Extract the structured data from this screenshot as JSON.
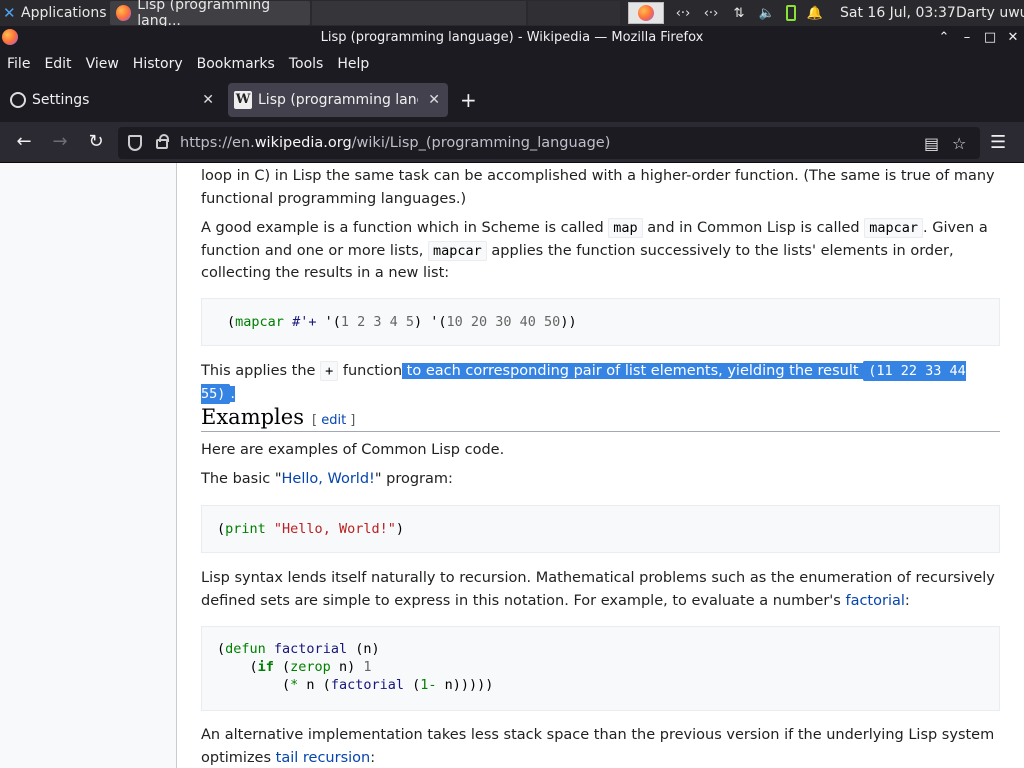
{
  "panel": {
    "applications_label": "Applications",
    "task_label": "Lisp (programming lang...",
    "clock": "Sat 16 Jul, 03:37",
    "user": "Darty uwu"
  },
  "window": {
    "title": "Lisp (programming language) - Wikipedia — Mozilla Firefox"
  },
  "menubar": [
    "File",
    "Edit",
    "View",
    "History",
    "Bookmarks",
    "Tools",
    "Help"
  ],
  "tabs": [
    {
      "label": "Settings"
    },
    {
      "label": "Lisp (programming language) - Wikipedia"
    }
  ],
  "urlbar": {
    "prefix": "https://en.",
    "domain": "wikipedia.org",
    "path": "/wiki/Lisp_(programming_language)"
  },
  "article": {
    "p1": "loop in C) in Lisp the same task can be accomplished with a higher-order function. (The same is true of many functional programming languages.)",
    "p2_a": "A good example is a function which in Scheme is called ",
    "p2_code1": "map",
    "p2_b": " and in Common Lisp is called ",
    "p2_code2": "mapcar",
    "p2_c": ". Given a function and one or more lists, ",
    "p2_code3": "mapcar",
    "p2_d": " applies the function successively to the lists' elements in order, collecting the results in a new list:",
    "code1": {
      "open": "(",
      "fn": "mapcar",
      "sym": "#'+",
      "quote1": " '(",
      "list1": "1 2 3 4 5",
      "mid": ") '(",
      "list2": "10 20 30 40 50",
      "close": "))"
    },
    "p3_a": "This applies the ",
    "p3_code": "+",
    "p3_b": " function",
    "p3_hl": " to each corresponding pair of list elements, yielding the result ",
    "p3_hl_code": "(11 22 33 44 55)",
    "p3_hl_end": ".",
    "heading": "Examples",
    "edit_open": "[ ",
    "edit_label": "edit",
    "edit_close": " ]",
    "p4": "Here are examples of Common Lisp code.",
    "p5_a": "The basic \"",
    "p5_link": "Hello, World!",
    "p5_b": "\" program:",
    "code2": {
      "open": "(",
      "fn": "print",
      "str": "\"Hello, World!\"",
      "close": ")"
    },
    "p6_a": "Lisp syntax lends itself naturally to recursion. Mathematical problems such as the enumeration of recursively defined sets are simple to express in this notation. For example, to evaluate a number's ",
    "p6_link": "factorial",
    "p6_b": ":",
    "code3": {
      "l1_kw": "defun",
      "l1_name": "factorial",
      "l1_args": " (n)",
      "l2_kw": "if",
      "l2_fn": "zerop",
      "l2_arg": " n) ",
      "l2_num": "1",
      "l3_fn": "*",
      "l3_a": " n (",
      "l3_fn2": "factorial",
      "l3_b": " (",
      "l3_fn3": "1-",
      "l3_c": " n)))))"
    },
    "p7_a": "An alternative implementation takes less stack space than the previous version if the underlying Lisp system optimizes ",
    "p7_link": "tail recursion",
    "p7_b": ":"
  },
  "colors": {
    "selection": "#3584e4",
    "link": "#0645ad",
    "chrome_dark": "#1c1b22"
  }
}
